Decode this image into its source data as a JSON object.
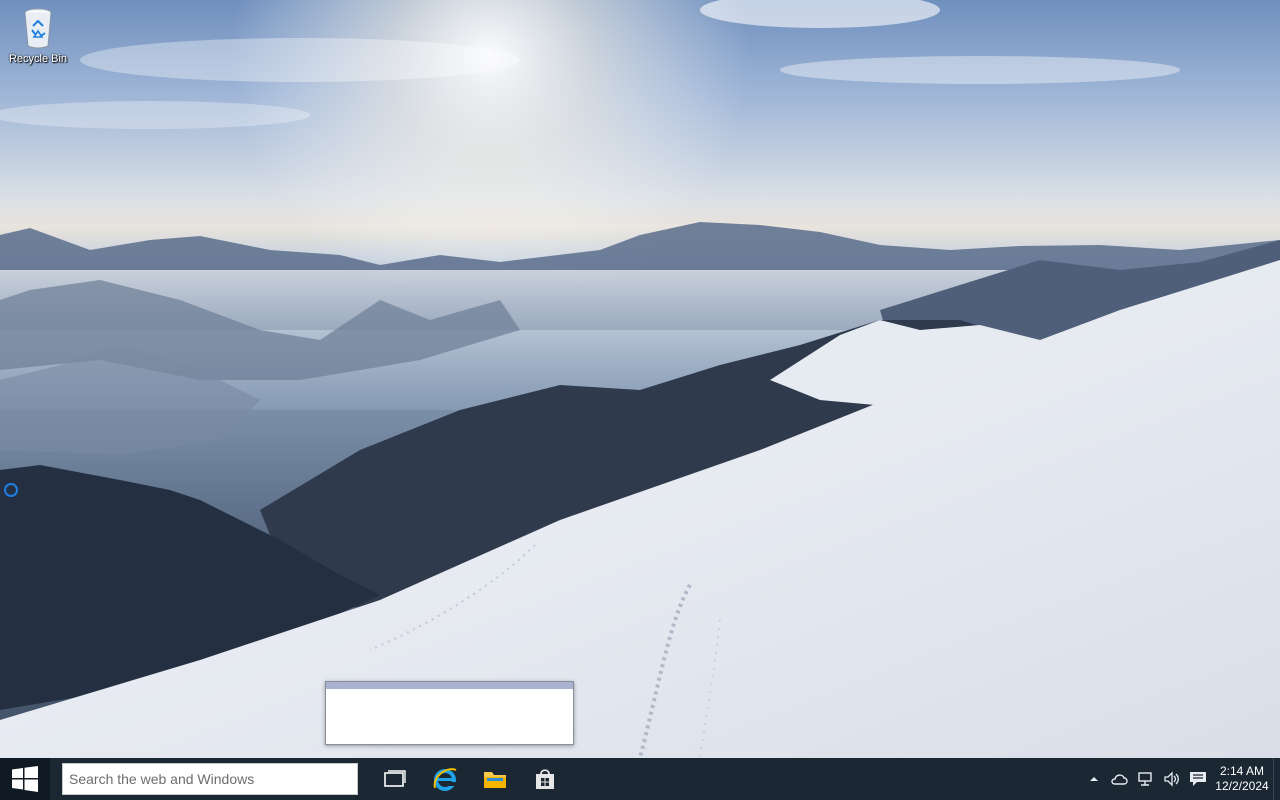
{
  "desktop": {
    "icons": [
      {
        "label": "Recycle Bin",
        "icon": "recycle-bin-icon"
      }
    ]
  },
  "taskbar": {
    "start_icon": "windows-logo-icon",
    "search_placeholder": "Search the web and Windows",
    "pinned": [
      {
        "name": "task-view",
        "icon": "task-view-icon"
      },
      {
        "name": "internet-explorer",
        "icon": "internet-explorer-icon"
      },
      {
        "name": "file-explorer",
        "icon": "folder-icon"
      },
      {
        "name": "store",
        "icon": "store-icon"
      }
    ],
    "tray": {
      "icons": [
        "chevron-up-icon",
        "onedrive-cloud-icon",
        "network-icon",
        "volume-icon",
        "action-center-icon"
      ],
      "time": "2:14 AM",
      "date": "12/2/2024"
    }
  },
  "colors": {
    "taskbar_bg": "#1b2733",
    "start_bg": "#0f1a24",
    "accent": "#1f7fe0"
  }
}
